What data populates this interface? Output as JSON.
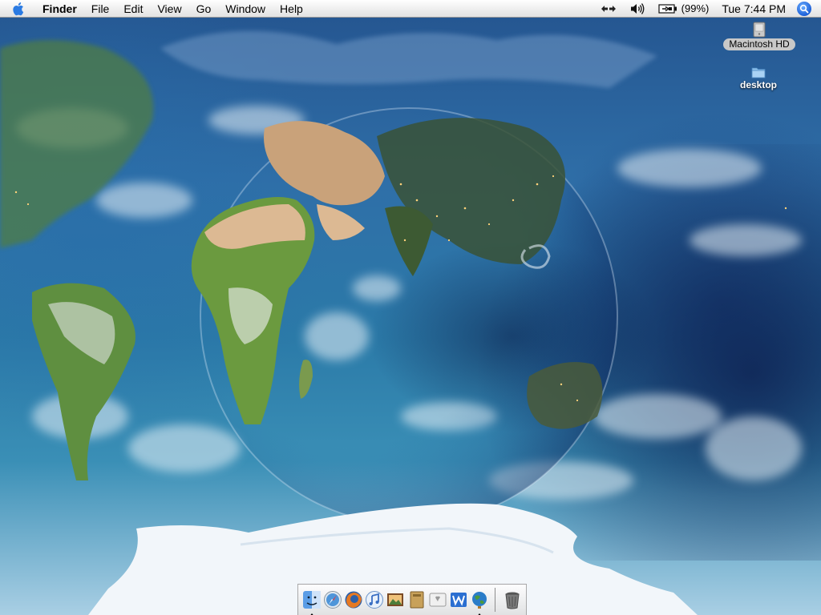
{
  "menubar": {
    "apple_icon": "apple-icon",
    "app_name": "Finder",
    "items": [
      "File",
      "Edit",
      "View",
      "Go",
      "Window",
      "Help"
    ],
    "status": {
      "network_icon": "network-arrows-icon",
      "volume_icon": "speaker-volume-icon",
      "battery_icon": "battery-charging-icon",
      "battery_percent": "(99%)",
      "clock": "Tue 7:44 PM",
      "spotlight_icon": "spotlight-search-icon"
    }
  },
  "desktop": {
    "icons": [
      {
        "label": "Macintosh HD",
        "icon": "hard-drive-icon",
        "selected": true
      },
      {
        "label": "desktop",
        "icon": "folder-icon",
        "selected": false
      }
    ]
  },
  "dock": {
    "apps": [
      {
        "name": "Finder",
        "icon": "finder-icon",
        "running": true
      },
      {
        "name": "Safari",
        "icon": "safari-compass-icon",
        "running": false
      },
      {
        "name": "Firefox",
        "icon": "firefox-icon",
        "running": false
      },
      {
        "name": "iTunes",
        "icon": "itunes-note-icon",
        "running": false
      },
      {
        "name": "iPhoto",
        "icon": "iphoto-icon",
        "running": false
      },
      {
        "name": "Preview",
        "icon": "preview-book-icon",
        "running": false
      },
      {
        "name": "Mac OS X",
        "icon": "mac-os-x-icon",
        "running": false
      },
      {
        "name": "Word",
        "icon": "word-w-icon",
        "running": false
      },
      {
        "name": "Globe",
        "icon": "globe-icon",
        "running": true
      }
    ],
    "trash_icon": "trash-icon"
  },
  "colors": {
    "menubar_bg": "#f1f1f1",
    "ocean": "#2b7aa8",
    "land_green": "#5a8a3a",
    "land_desert": "#d8b58a",
    "antarctica": "#f2f6fa",
    "spotlight_blue": "#1b5fd8"
  }
}
